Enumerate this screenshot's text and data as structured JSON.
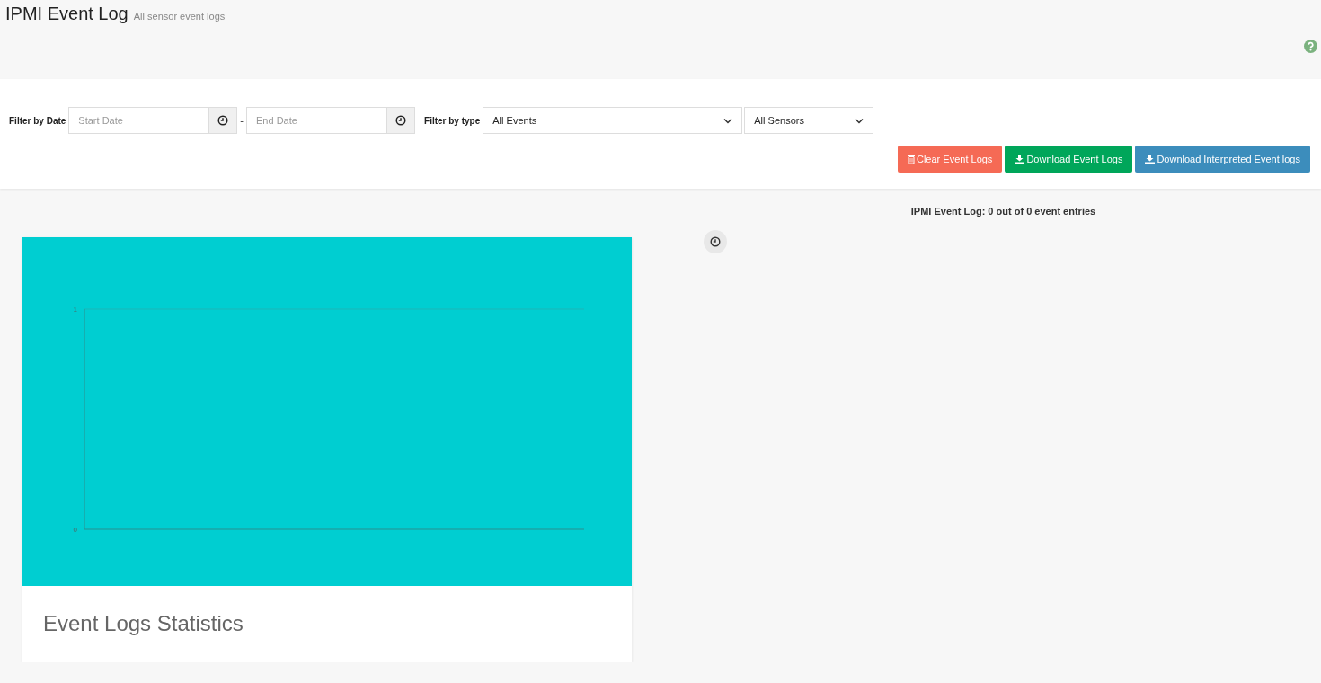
{
  "header": {
    "title": "IPMI Event Log",
    "subtitle": "All sensor event logs"
  },
  "filters": {
    "date_label": "Filter by Date",
    "start_date": {
      "placeholder": "Start Date"
    },
    "separator": "-",
    "end_date": {
      "placeholder": "End Date"
    },
    "type_label": "Filter by type",
    "event_type": "All Events",
    "sensor": "All Sensors"
  },
  "buttons": [
    {
      "kind": "clear",
      "label": "Clear Event Logs"
    },
    {
      "kind": "download",
      "label": "Download Event Logs"
    },
    {
      "kind": "interpreted",
      "label": "Download Interpreted Event logs"
    }
  ],
  "summary": "IPMI Event Log: 0 out of 0 event entries",
  "chart_card": {
    "title": "Event Logs Statistics",
    "axis_labels": [
      "1",
      "0"
    ]
  }
}
